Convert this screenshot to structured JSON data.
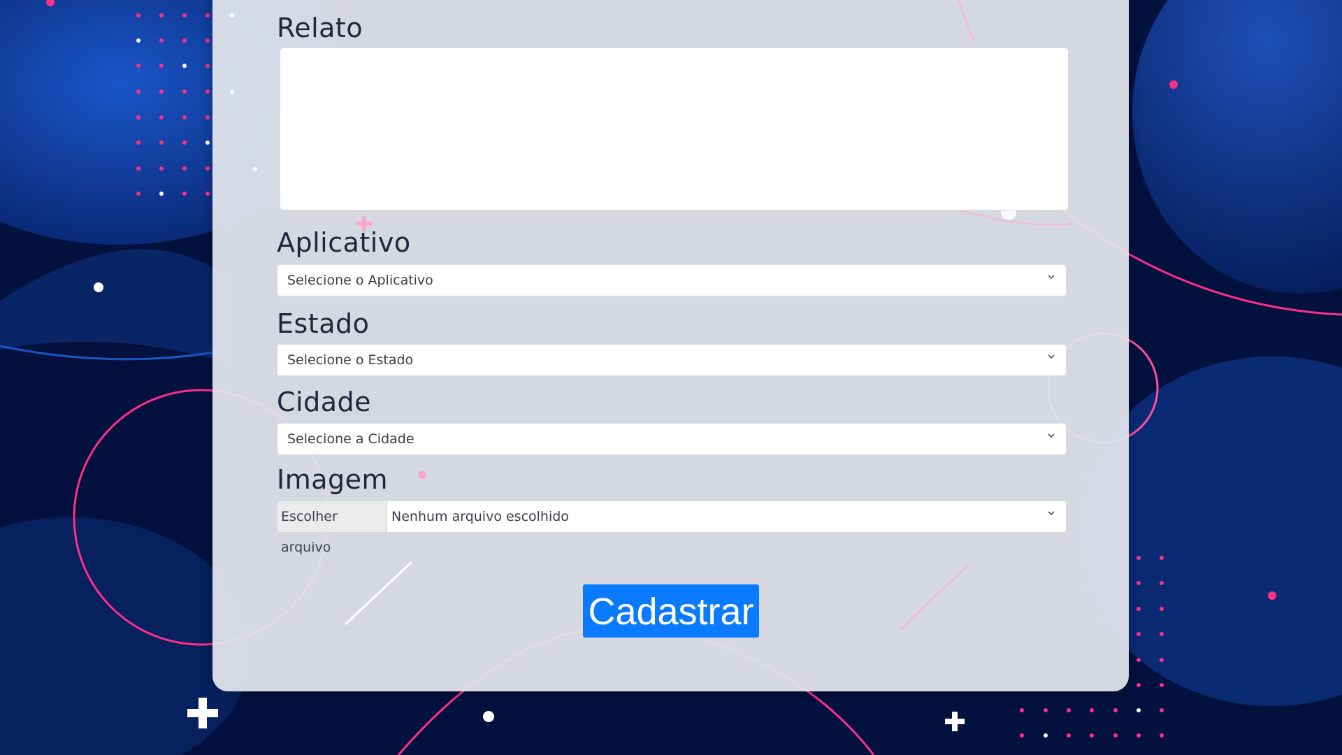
{
  "form": {
    "report_label": "Relato",
    "app_label": "Aplicativo",
    "app_select_value": "Selecione o Aplicativo",
    "state_label": "Estado",
    "state_select_value": "Selecione o Estado",
    "city_label": "Cidade",
    "city_select_value": "Selecione a Cidade",
    "image_label": "Imagem",
    "file_button_label": "Escolher arquivo",
    "file_status": "Nenhum arquivo escolhido",
    "submit_label": "Cadastrar"
  },
  "icons": {
    "select_arrow": "chevron-down-icon"
  },
  "colors": {
    "background": "#03113f",
    "card": "#e2e4ec",
    "accent_pink": "#ff2e8a",
    "button_blue": "#0a7bff"
  }
}
